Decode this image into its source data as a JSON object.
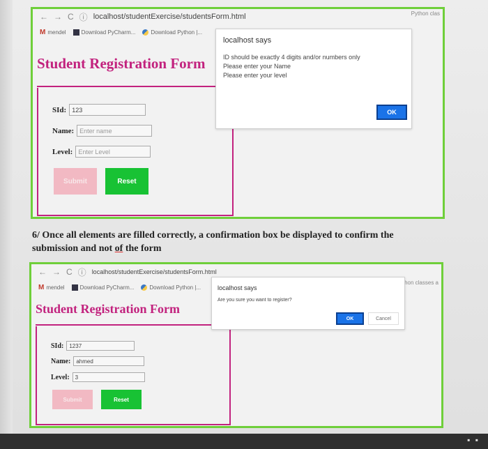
{
  "screenshot_1": {
    "browser": {
      "url": "localhost/studentExercise/studentsForm.html",
      "bookmarks": [
        "mendel",
        "Download PyCharm...",
        "Download Python |..."
      ],
      "right_label": "Python clas"
    },
    "form": {
      "title": "Student Registration Form",
      "sid_label": "SId:",
      "sid_value": "123",
      "name_label": "Name:",
      "name_placeholder": "Enter name",
      "level_label": "Level:",
      "level_placeholder": "Enter Level",
      "submit_label": "Submit",
      "reset_label": "Reset"
    },
    "dialog": {
      "title": "localhost says",
      "messages": [
        "ID should be exactly 4 digits and/or numbers only",
        "Please enter your Name",
        "Please enter your level"
      ],
      "ok_label": "OK"
    }
  },
  "caption": {
    "text_before": "6/ Once all elements are filled correctly, a confirmation box be displayed to confirm the submission and not ",
    "underlined": "of",
    "text_after": " the form"
  },
  "screenshot_2": {
    "browser": {
      "url": "localhost/studentExercise/studentsForm.html",
      "bookmarks": [
        "mendel",
        "Download PyCharm...",
        "Download Python |..."
      ],
      "right_label": "Python classes a"
    },
    "form": {
      "title": "Student Registration Form",
      "sid_label": "SId:",
      "sid_value": "1237",
      "name_label": "Name:",
      "name_value": "ahmed",
      "level_label": "Level:",
      "level_value": "3",
      "submit_label": "Submit",
      "reset_label": "Reset"
    },
    "dialog": {
      "title": "localhost says",
      "message": "Are you sure you want to register?",
      "ok_label": "OK",
      "cancel_label": "Cancel"
    }
  },
  "colors": {
    "frame_border": "#6fcf3a",
    "title_magenta": "#c2227e",
    "reset_green": "#18c234",
    "submit_pink": "#f2b9c3",
    "ok_blue": "#1a73e8"
  },
  "icons": [
    "back-arrow-icon",
    "forward-arrow-icon",
    "reload-icon",
    "info-icon",
    "bookmark-folder-icon",
    "python-icon"
  ]
}
